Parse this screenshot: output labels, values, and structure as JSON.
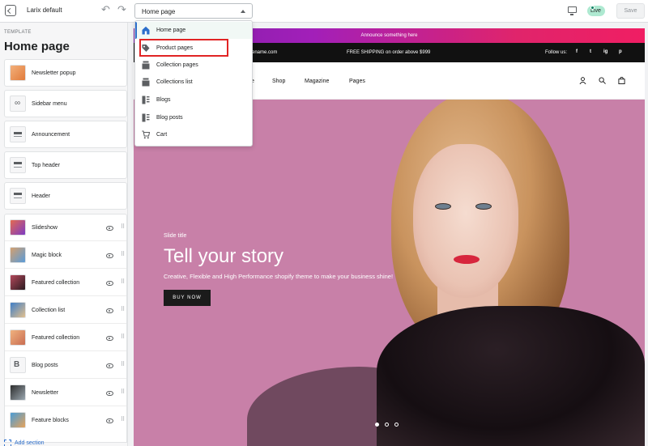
{
  "topbar": {
    "theme_name": "Larix default",
    "page_select": "Home page",
    "live_label": "Live",
    "save_label": "Save"
  },
  "sidebar": {
    "template_label": "TEMPLATE",
    "title": "Home page",
    "sections": [
      {
        "label": "Newsletter popup"
      },
      {
        "label": "Sidebar menu"
      },
      {
        "label": "Announcement"
      },
      {
        "label": "Top header"
      },
      {
        "label": "Header"
      },
      {
        "label": "Slideshow"
      },
      {
        "label": "Magic block"
      },
      {
        "label": "Featured collection"
      },
      {
        "label": "Collection list"
      },
      {
        "label": "Featured collection"
      },
      {
        "label": "Blog posts"
      },
      {
        "label": "Newsletter"
      },
      {
        "label": "Feature blocks"
      }
    ],
    "add_section": "Add section"
  },
  "dropdown": {
    "items": [
      {
        "label": "Home page",
        "icon": "home-icon"
      },
      {
        "label": "Product pages",
        "icon": "tag-icon"
      },
      {
        "label": "Collection pages",
        "icon": "collection-icon"
      },
      {
        "label": "Collections list",
        "icon": "collection-icon"
      },
      {
        "label": "Blogs",
        "icon": "blog-icon"
      },
      {
        "label": "Blog posts",
        "icon": "blog-icon"
      },
      {
        "label": "Cart",
        "icon": "cart-icon"
      }
    ]
  },
  "preview": {
    "announcement": "Announce something here",
    "email_fragment": "ename.com",
    "shipping": "FREE SHIPPING on order above $999",
    "follow": "Follow us:",
    "social": [
      "f",
      "t",
      "ig",
      "p"
    ],
    "nav": [
      "e",
      "Shop",
      "Magazine",
      "Pages"
    ],
    "slide_subtitle": "Slide title",
    "slide_title": "Tell your story",
    "slide_desc": "Creative, Flexible and High Performance shopify theme to make your business shine!",
    "buy_button": "BUY NOW"
  },
  "colors": {
    "accent": "#2c6ecb",
    "live_badge": "#aee9d1",
    "hero_bg": "#c880a8",
    "highlight": "#e12424"
  }
}
